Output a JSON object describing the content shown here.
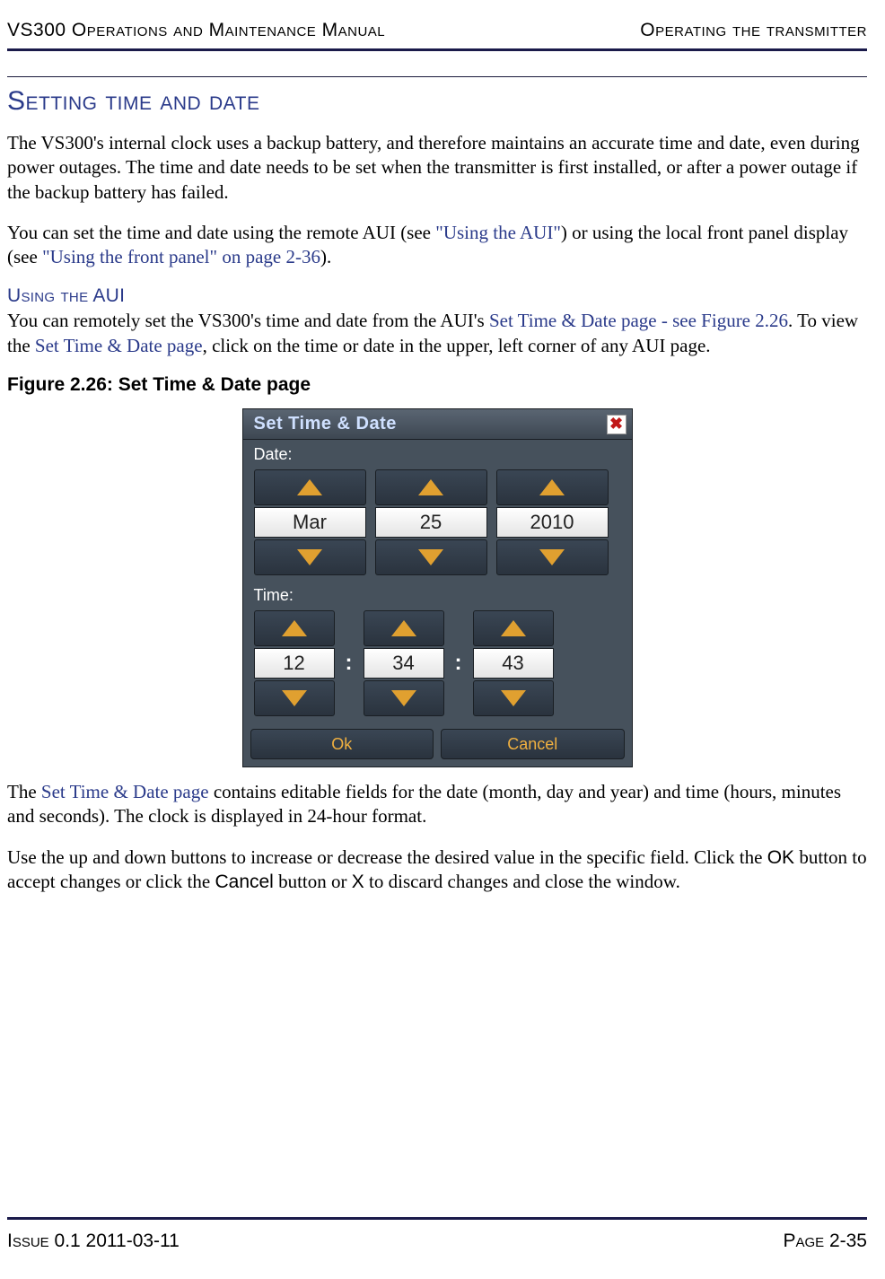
{
  "header": {
    "left": "VS300 Operations and Maintenance Manual",
    "right": "Operating the transmitter"
  },
  "section_heading": "Setting time and date",
  "para1": "The VS300's internal clock uses a backup battery, and therefore maintains an accurate time and date, even during power outages. The time and date needs to be set when the transmitter is first installed, or after a power outage if the backup battery has failed.",
  "para2_a": "You can set the time and date using the remote AUI (see ",
  "para2_link1": "\"Using the AUI\"",
  "para2_b": ") or using the local front panel display (see ",
  "para2_link2": "\"Using the front panel\" on page 2-36",
  "para2_c": ").",
  "sub_heading": "Using the AUI",
  "para3_a": "You can remotely set the VS300's time and date from the AUI's ",
  "para3_link1": "Set Time & Date page - see Figure 2.26",
  "para3_b": ". To view the ",
  "para3_link2": "Set Time & Date page",
  "para3_c": ", click on the time or date in the upper, left corner of any AUI page.",
  "figure_caption": "Figure 2.26: Set Time & Date page",
  "dialog": {
    "title": "Set Time & Date",
    "close": "✖",
    "date_label": "Date:",
    "time_label": "Time:",
    "date": {
      "month": "Mar",
      "day": "25",
      "year": "2010"
    },
    "time": {
      "hour": "12",
      "minute": "34",
      "second": "43"
    },
    "ok": "Ok",
    "cancel": "Cancel"
  },
  "para4_a": "The ",
  "para4_link1": "Set Time & Date page",
  "para4_b": " contains editable fields for the date (month, day and year) and time (hours, minutes and seconds). The clock is displayed in 24-hour format.",
  "para5_a": "Use the up and down buttons to increase or decrease the desired value in the specific field. Click the ",
  "para5_ok": "OK",
  "para5_b": " button to accept changes or click the ",
  "para5_cancel": "Cancel",
  "para5_c": " button or ",
  "para5_x": "X",
  "para5_d": " to discard changes and close the window.",
  "footer": {
    "left": "Issue 0.1  2011-03-11",
    "right": "Page 2-35"
  }
}
